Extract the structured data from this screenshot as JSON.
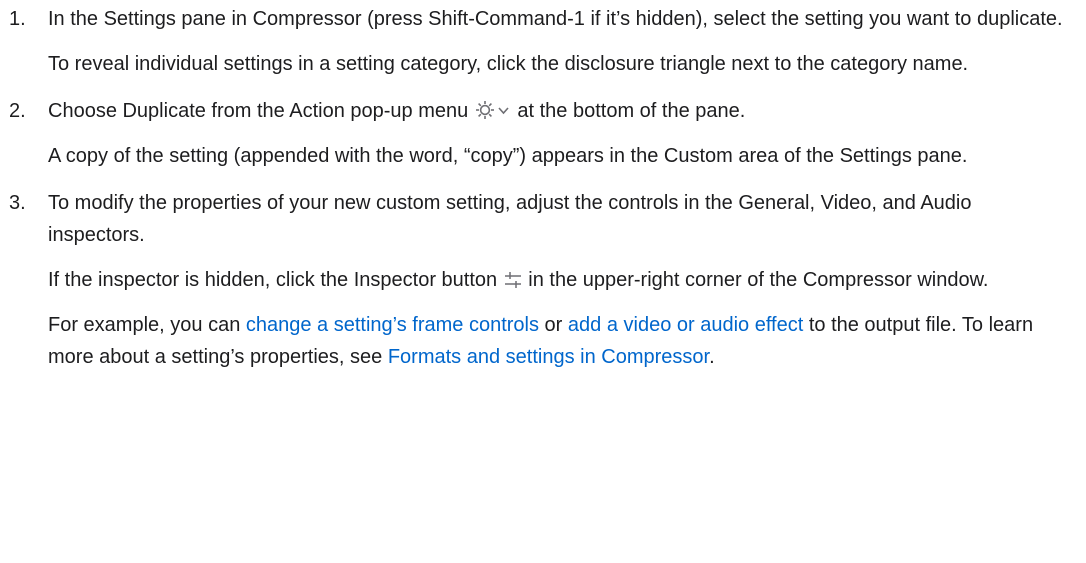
{
  "steps": [
    {
      "number": "1.",
      "instruction": "In the Settings pane in Compressor (press Shift-Command-1 if it’s hidden), select the setting you want to duplicate.",
      "note": "To reveal individual settings in a setting category, click the disclosure triangle next to the category name."
    },
    {
      "number": "2.",
      "instruction_before_icon": "Choose Duplicate from the Action pop-up menu ",
      "icon": "gear-chevron-icon",
      "instruction_after_icon": " at the bottom of the pane.",
      "note": "A copy of the setting (appended with the word, “copy”) appears in the Custom area of the Settings pane."
    },
    {
      "number": "3.",
      "instruction": "To modify the properties of your new custom setting, adjust the controls in the General, Video, and Audio inspectors.",
      "note_before_icon": "If the inspector is hidden, click the Inspector button ",
      "icon": "inspector-sliders-icon",
      "note_after_icon": " in the upper-right corner of the Compressor window.",
      "example_prefix": "For example, you can ",
      "link_frame_controls": "change a setting’s frame controls",
      "example_or": " or ",
      "link_effect": "add a video or audio effect",
      "example_middle": " to the output file. To learn more about a setting’s properties, see ",
      "link_formats": "Formats and settings in Compressor",
      "example_end": "."
    }
  ],
  "colors": {
    "text": "#1d1d1f",
    "link": "#0066cc",
    "icon": "#6e6e73"
  }
}
